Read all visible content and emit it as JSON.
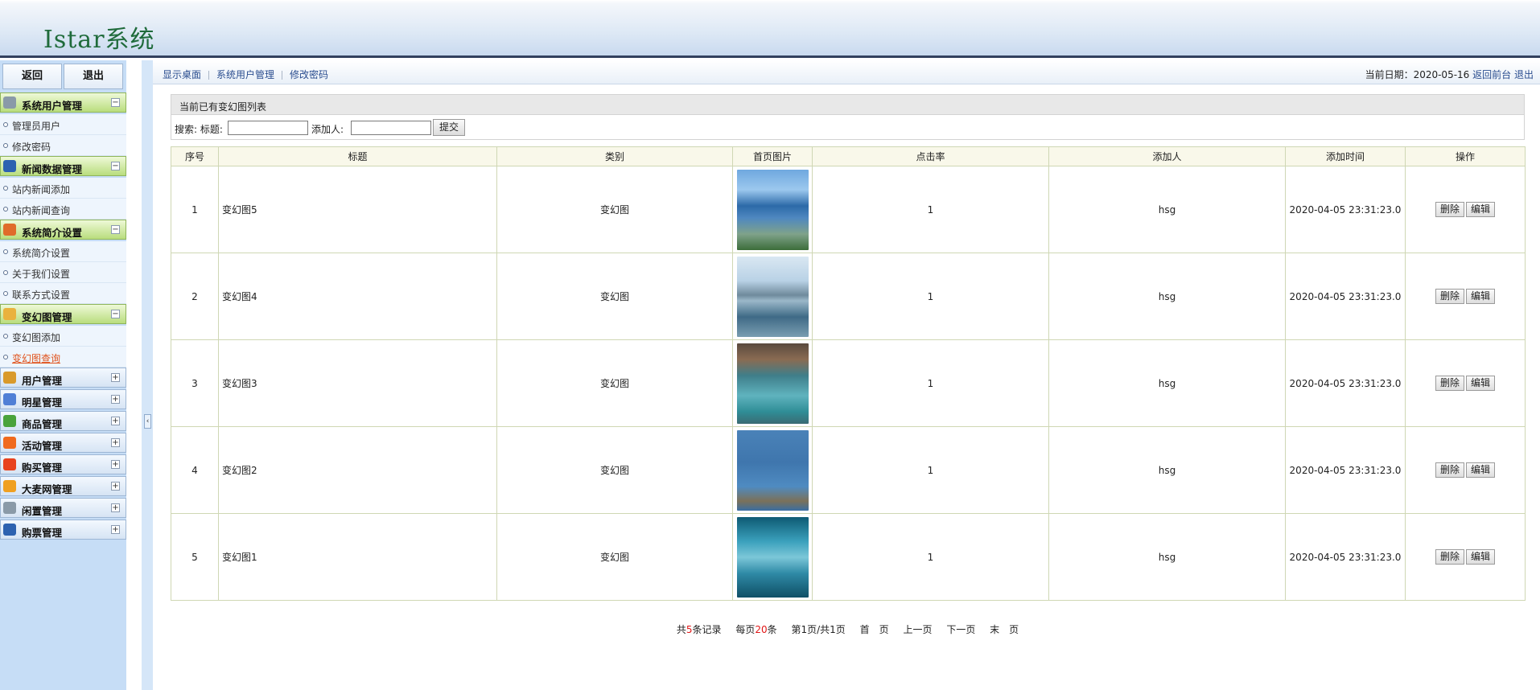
{
  "app": {
    "title": "Istar系统"
  },
  "sidebar": {
    "back_label": "返回",
    "logout_label": "退出",
    "groups": [
      {
        "label": "系统用户管理",
        "icon": "gear-icon",
        "color": "#8a9aa8",
        "open": true,
        "items": [
          {
            "label": "管理员用户"
          },
          {
            "label": "修改密码"
          }
        ]
      },
      {
        "label": "新闻数据管理",
        "icon": "monitor-icon",
        "color": "#2d62b0",
        "open": true,
        "items": [
          {
            "label": "站内新闻添加"
          },
          {
            "label": "站内新闻查询"
          }
        ]
      },
      {
        "label": "系统简介设置",
        "icon": "calendar-icon",
        "color": "#e06b2a",
        "open": true,
        "items": [
          {
            "label": "系统简介设置"
          },
          {
            "label": "关于我们设置"
          },
          {
            "label": "联系方式设置"
          }
        ]
      },
      {
        "label": "变幻图管理",
        "icon": "folder-icon",
        "color": "#e9b23e",
        "open": true,
        "items": [
          {
            "label": "变幻图添加"
          },
          {
            "label": "变幻图查询",
            "active": true
          }
        ]
      },
      {
        "label": "用户管理",
        "icon": "user-icon",
        "color": "#d99a2b",
        "open": false,
        "items": []
      },
      {
        "label": "明星管理",
        "icon": "bar-chart-icon",
        "color": "#4f7fd6",
        "open": false,
        "items": []
      },
      {
        "label": "商品管理",
        "icon": "vip-icon",
        "color": "#4aa33b",
        "open": false,
        "items": []
      },
      {
        "label": "活动管理",
        "icon": "taobao-icon",
        "color": "#f06a1e",
        "open": false,
        "items": []
      },
      {
        "label": "购买管理",
        "icon": "s-icon",
        "color": "#e8421e",
        "open": false,
        "items": []
      },
      {
        "label": "大麦网管理",
        "icon": "badge-icon",
        "color": "#f0a020",
        "open": false,
        "items": []
      },
      {
        "label": "闲置管理",
        "icon": "gear-icon",
        "color": "#8a9aa8",
        "open": false,
        "items": []
      },
      {
        "label": "购票管理",
        "icon": "monitor-icon",
        "color": "#2d62b0",
        "open": false,
        "items": []
      }
    ]
  },
  "topnav": {
    "links": [
      "显示桌面",
      "系统用户管理",
      "修改密码"
    ],
    "date_prefix": "当前日期：2020-05-16",
    "back_front": "返回前台",
    "logout": "退出"
  },
  "panel": {
    "title": "当前已有变幻图列表"
  },
  "search": {
    "label": "搜索: 标题:",
    "adder_label": "添加人:",
    "title_value": "",
    "adder_value": "",
    "submit": "提交"
  },
  "table": {
    "headers": [
      "序号",
      "标题",
      "类别",
      "首页图片",
      "点击率",
      "添加人",
      "添加时间",
      "操作"
    ],
    "delete_label": "删除",
    "edit_label": "编辑",
    "rows": [
      {
        "no": "1",
        "title": "变幻图5",
        "category": "变幻图",
        "clicks": "1",
        "adder": "hsg",
        "time": "2020-04-05 23:31:23.0",
        "img": "lake-view"
      },
      {
        "no": "2",
        "title": "变幻图4",
        "category": "变幻图",
        "clicks": "1",
        "adder": "hsg",
        "time": "2020-04-05 23:31:23.0",
        "img": "city-skyline"
      },
      {
        "no": "3",
        "title": "变幻图3",
        "category": "变幻图",
        "clicks": "1",
        "adder": "hsg",
        "time": "2020-04-05 23:31:23.0",
        "img": "turquoise-lake"
      },
      {
        "no": "4",
        "title": "变幻图2",
        "category": "变幻图",
        "clicks": "1",
        "adder": "hsg",
        "time": "2020-04-05 23:31:23.0",
        "img": "blue-water"
      },
      {
        "no": "5",
        "title": "变幻图1",
        "category": "变幻图",
        "clicks": "1",
        "adder": "hsg",
        "time": "2020-04-05 23:31:23.0",
        "img": "misty-lake"
      }
    ]
  },
  "pager": {
    "total_prefix": "共",
    "total": "5",
    "total_suffix": "条记录",
    "per_prefix": "每页",
    "per": "20",
    "per_suffix": "条",
    "page_info": "第1页/共1页",
    "first": "首　页",
    "prev": "上一页",
    "next": "下一页",
    "last": "末　页"
  }
}
